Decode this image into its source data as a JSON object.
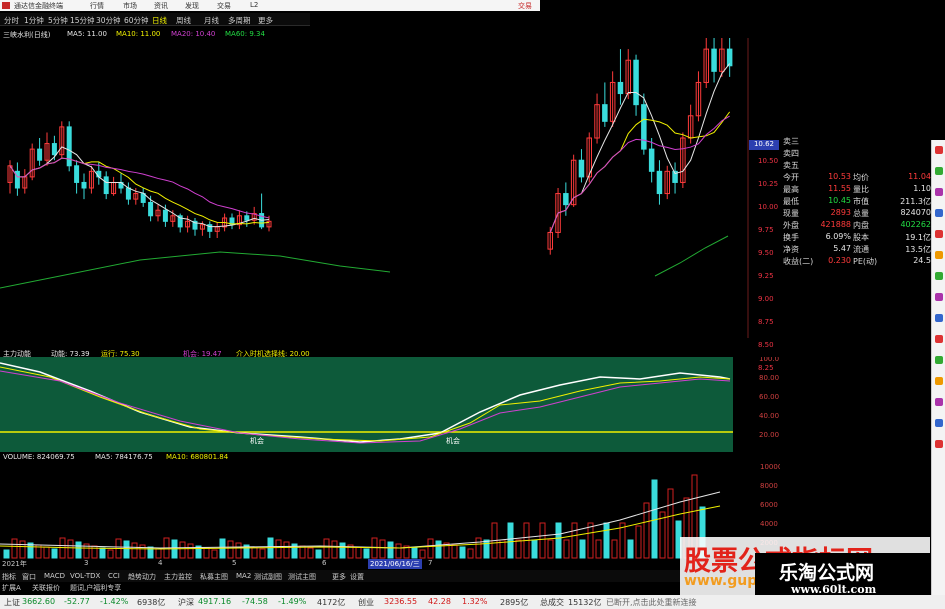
{
  "titlebar": {
    "title": "通达信金融终端",
    "menu": [
      "行情",
      "市场",
      "资讯",
      "发现",
      "交易",
      "L2"
    ],
    "right": "交易"
  },
  "periods": [
    "分时",
    "1分钟",
    "5分钟",
    "15分钟",
    "30分钟",
    "60分钟",
    "日线",
    "周线",
    "月线",
    "多周期",
    "更多"
  ],
  "period_active": 6,
  "ma_legend": {
    "stock": "三峡水利(日线)",
    "ma5": "MA5: 11.00",
    "ma10": "MA10: 11.00",
    "ma20": "MA20: 10.40",
    "ma60": "MA60: 9.34"
  },
  "price_axis": [
    "10.50",
    "10.25",
    "10.00",
    "9.75",
    "9.50",
    "9.25",
    "9.00",
    "8.75",
    "8.50",
    "8.25"
  ],
  "latest_price_tag": "10.62",
  "sidebar": {
    "rows": [
      {
        "l": "卖三",
        "v1": "",
        "l2": "",
        "v2": ""
      },
      {
        "l": "卖四",
        "v1": "",
        "l2": "",
        "v2": ""
      },
      {
        "l": "卖五",
        "v1": "",
        "l2": "",
        "v2": ""
      },
      {
        "l": "今开",
        "v1": "10.53",
        "l2": "均价",
        "v2": "11.04"
      },
      {
        "l": "最高",
        "v1": "11.55",
        "l2": "量比",
        "v2": "1.10"
      },
      {
        "l": "最低",
        "v1": "10.45",
        "l2": "市值",
        "v2": "211.3亿"
      },
      {
        "l": "现量",
        "v1": "2893",
        "l2": "总量",
        "v2": "824070"
      },
      {
        "l": "外盘",
        "v1": "421888",
        "l2": "内盘",
        "v2": "402262"
      },
      {
        "l": "换手",
        "v1": "6.09%",
        "l2": "股本",
        "v2": "19.1亿"
      },
      {
        "l": "净资",
        "v1": "5.47",
        "l2": "流通",
        "v2": "13.5亿"
      },
      {
        "l": "收益(二)",
        "v1": "0.230",
        "l2": "PE(动)",
        "v2": "24.5"
      }
    ]
  },
  "indicator": {
    "name": "主力动能",
    "a": "动能: 73.39",
    "b": "运行: 75.30",
    "c": "机会: 19.47",
    "d": "介入时机选择线: 20.00",
    "label1": "机会",
    "label2": "机会",
    "axis": [
      "100.0",
      "80.00",
      "60.00",
      "40.00",
      "20.00"
    ]
  },
  "volume": {
    "name": "VOLUME: 824069.75",
    "ma5": "MA5: 784176.75",
    "ma10": "MA10: 680801.84",
    "axis": [
      "10000",
      "8000",
      "6000",
      "4000",
      "2000"
    ]
  },
  "dates": {
    "d1": "2021年",
    "d2": "3",
    "d3": "4",
    "d4": "5",
    "d5": "6",
    "d6": "2021/06/16/三",
    "d7": "7"
  },
  "tabs": [
    "指标",
    "窗口",
    "MACD",
    "VOL-TDX",
    "CCI",
    "趋势动力",
    "主力监控",
    "私募主图",
    "MA2",
    "测试副图",
    "测试主图",
    "更多",
    "设置"
  ],
  "tabs2": [
    "扩展A",
    "关联报价",
    "题词,户福利专享"
  ],
  "statusbar": {
    "sh_name": "上证",
    "sh_price": "3662.60",
    "sh_chg": "-52.77",
    "sh_pct": "-1.42%",
    "sh_amt": "6938亿",
    "sz_name": "沪深",
    "sz_price": "4917.16",
    "sz_chg": "-74.58",
    "sz_pct": "-1.49%",
    "sz_amt": "4172亿",
    "cy_name": "创业",
    "cy_price": "3236.55",
    "cy_chg": "42.28",
    "cy_pct": "1.32%",
    "cy_amt": "2895亿",
    "total_label": "总成交",
    "total_val": "15132亿",
    "note": "已断开,点击此处重新连接"
  },
  "watermark": {
    "text1": "股票公式指标网",
    "text2": "www.gupiaozhibiao.com",
    "logo_text": "乐淘公式网",
    "logo_url": "www.60lt.com"
  },
  "chart_data": {
    "type": "candlestick",
    "ylim": [
      8.0,
      10.7
    ],
    "candles": [
      [
        9.4,
        9.55,
        9.3,
        9.6
      ],
      [
        9.5,
        9.35,
        9.28,
        9.58
      ],
      [
        9.35,
        9.45,
        9.3,
        9.52
      ],
      [
        9.45,
        9.7,
        9.42,
        9.75
      ],
      [
        9.7,
        9.6,
        9.55,
        9.8
      ],
      [
        9.6,
        9.75,
        9.55,
        9.85
      ],
      [
        9.75,
        9.65,
        9.6,
        9.82
      ],
      [
        9.65,
        9.9,
        9.62,
        9.95
      ],
      [
        9.9,
        9.55,
        9.5,
        9.95
      ],
      [
        9.55,
        9.4,
        9.3,
        9.6
      ],
      [
        9.4,
        9.35,
        9.25,
        9.48
      ],
      [
        9.35,
        9.5,
        9.3,
        9.55
      ],
      [
        9.5,
        9.45,
        9.38,
        9.58
      ],
      [
        9.45,
        9.3,
        9.25,
        9.5
      ],
      [
        9.3,
        9.4,
        9.28,
        9.45
      ],
      [
        9.4,
        9.35,
        9.3,
        9.48
      ],
      [
        9.35,
        9.25,
        9.2,
        9.4
      ],
      [
        9.25,
        9.3,
        9.2,
        9.35
      ],
      [
        9.3,
        9.22,
        9.18,
        9.35
      ],
      [
        9.22,
        9.1,
        9.05,
        9.28
      ],
      [
        9.1,
        9.15,
        9.05,
        9.2
      ],
      [
        9.15,
        9.05,
        9.0,
        9.2
      ],
      [
        9.05,
        9.1,
        9.0,
        9.15
      ],
      [
        9.1,
        9.0,
        8.95,
        9.12
      ],
      [
        9.0,
        9.05,
        8.95,
        9.1
      ],
      [
        9.05,
        8.98,
        8.92,
        9.08
      ],
      [
        8.98,
        9.02,
        8.92,
        9.05
      ],
      [
        9.02,
        8.96,
        8.9,
        9.05
      ],
      [
        8.96,
        9.0,
        8.9,
        9.04
      ],
      [
        9.0,
        9.08,
        8.96,
        9.12
      ],
      [
        9.08,
        9.02,
        8.98,
        9.12
      ],
      [
        9.02,
        9.1,
        8.98,
        9.15
      ],
      [
        9.1,
        9.06,
        9.0,
        9.14
      ],
      [
        9.06,
        9.12,
        9.02,
        9.18
      ],
      [
        9.12,
        9.0,
        8.98,
        9.3
      ],
      [
        9.0,
        9.05,
        8.96,
        9.1
      ]
    ],
    "candles_right": [
      [
        8.8,
        8.95,
        8.75,
        9.0
      ],
      [
        8.95,
        9.3,
        8.9,
        9.35
      ],
      [
        9.3,
        9.2,
        9.1,
        9.4
      ],
      [
        9.2,
        9.6,
        9.18,
        9.65
      ],
      [
        9.6,
        9.45,
        9.4,
        9.7
      ],
      [
        9.45,
        9.8,
        9.4,
        9.85
      ],
      [
        9.8,
        10.1,
        9.75,
        10.2
      ],
      [
        10.1,
        9.95,
        9.9,
        10.3
      ],
      [
        9.95,
        10.3,
        9.9,
        10.4
      ],
      [
        10.3,
        10.2,
        10.1,
        10.6
      ],
      [
        10.2,
        10.5,
        10.15,
        10.6
      ],
      [
        10.5,
        10.1,
        10.0,
        10.55
      ],
      [
        10.1,
        9.7,
        9.65,
        10.2
      ],
      [
        9.7,
        9.5,
        9.4,
        9.8
      ],
      [
        9.5,
        9.3,
        9.2,
        9.6
      ],
      [
        9.3,
        9.5,
        9.25,
        9.55
      ],
      [
        9.5,
        9.4,
        9.3,
        9.58
      ],
      [
        9.4,
        9.8,
        9.35,
        9.85
      ],
      [
        9.8,
        10.0,
        9.75,
        10.1
      ],
      [
        10.0,
        10.3,
        9.95,
        10.4
      ],
      [
        10.3,
        10.6,
        10.25,
        10.7
      ],
      [
        10.6,
        10.4,
        10.3,
        10.7
      ],
      [
        10.4,
        10.6,
        10.35,
        10.7
      ],
      [
        10.6,
        10.45,
        10.35,
        10.7
      ]
    ]
  }
}
